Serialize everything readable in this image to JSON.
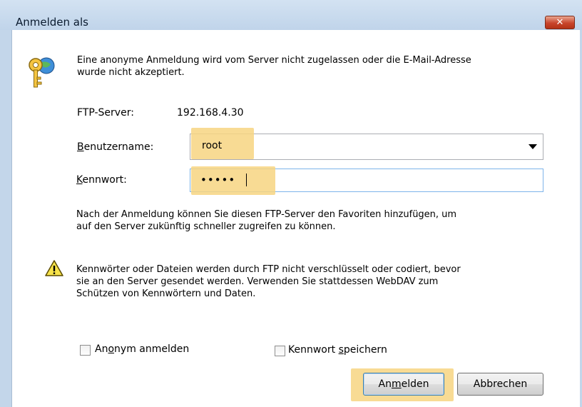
{
  "window": {
    "title": "Anmelden als"
  },
  "message": {
    "line1": "Eine anonyme Anmeldung wird vom Server nicht zugelassen oder die E-Mail-Adresse",
    "line2": "wurde nicht akzeptiert."
  },
  "ftp": {
    "label": "FTP-Server:",
    "value": "192.168.4.30"
  },
  "username": {
    "label_hotkey": "B",
    "label_rest": "enutzername:",
    "value": "root"
  },
  "password": {
    "label_hotkey": "K",
    "label_rest": "ennwort:",
    "masked_value": "•••••"
  },
  "info": {
    "line1": "Nach der Anmeldung können Sie diesen FTP-Server den Favoriten hinzufügen, um",
    "line2": "auf den Server zukünftig schneller zugreifen zu können."
  },
  "warning": {
    "line1": "Kennwörter oder Dateien werden durch FTP nicht verschlüsselt oder codiert, bevor",
    "line2": "sie an den Server gesendet werden. Verwenden Sie stattdessen WebDAV zum",
    "line3": "Schützen von Kennwörtern und Daten."
  },
  "options": {
    "anonymous": {
      "pre": "An",
      "hotkey": "o",
      "post": "nym anmelden",
      "checked": false
    },
    "save_password": {
      "pre": "Kennwort ",
      "hotkey": "s",
      "post": "peichern",
      "checked": false
    }
  },
  "buttons": {
    "login": {
      "pre": "An",
      "hotkey": "m",
      "post": "elden"
    },
    "cancel": {
      "label": "Abbrechen"
    }
  },
  "colors": {
    "highlight": "#f7d581",
    "titlebar": "#c3d6ea",
    "close_button": "#c8452c"
  },
  "icons": {
    "header": "keys-globe-icon",
    "warning": "warning-icon",
    "close": "close-icon",
    "dropdown": "chevron-down-icon"
  }
}
